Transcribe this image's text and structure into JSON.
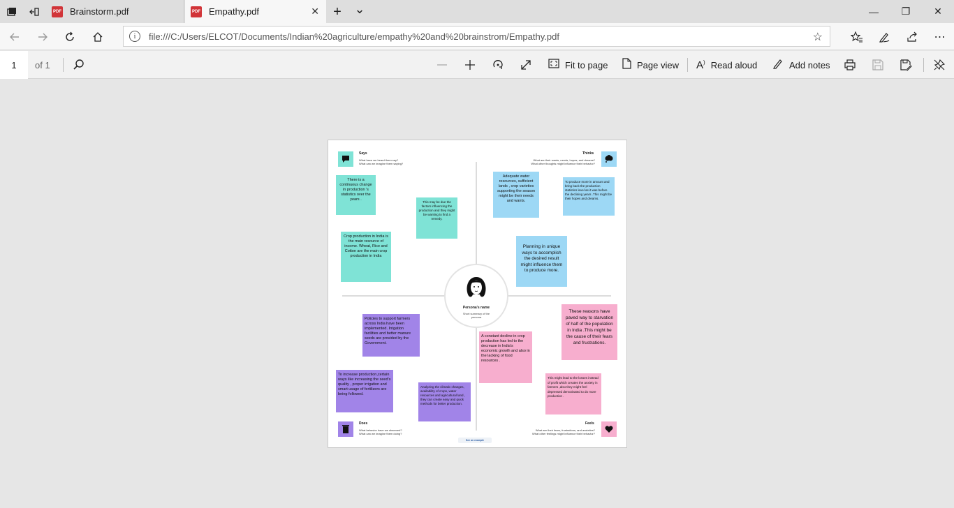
{
  "tabs": [
    {
      "label": "Brainstorm.pdf",
      "active": false
    },
    {
      "label": "Empathy.pdf",
      "active": true
    }
  ],
  "icons": {
    "pdf_badge": "PDF",
    "tab_close": "✕",
    "new_tab": "+",
    "tab_list": "⌄",
    "minimize": "—",
    "maximize": "❐",
    "window_close": "✕"
  },
  "address_bar": {
    "url": "file:///C:/Users/ELCOT/Documents/Indian%20agriculture/empathy%20and%20brainstrom/Empathy.pdf"
  },
  "pdf_toolbar": {
    "page_number": "1",
    "page_of": "of 1",
    "fit_to_page": "Fit to page",
    "page_view": "Page view",
    "read_aloud": "Read aloud",
    "add_notes": "Add notes"
  },
  "document": {
    "persona": {
      "name": "Persona's name",
      "summary": "Short summary of the persona"
    },
    "quadrants": {
      "says": {
        "title": "Says",
        "desc1": "What have we heard them say?",
        "desc2": "What can we imagine them saying?"
      },
      "thinks": {
        "title": "Thinks",
        "desc1": "What are their wants, needs, hopes, and dreams?",
        "desc2": "What other thoughts might influence their behavior?"
      },
      "does": {
        "title": "Does",
        "desc1": "What behavior have we observed?",
        "desc2": "What can we imagine them doing?"
      },
      "feels": {
        "title": "Feels",
        "desc1": "What are their fears, frustrations, and anxieties?",
        "desc2": "What other feelings might influence their behavior?"
      }
    },
    "notes": {
      "says_1": "There is a continuous change in production 's statistics over the years .",
      "says_2": "This may be due the factors influencing the production and they might be wanting to find a remedy.",
      "says_3": "Crop production in India is the main resource of income. Wheat, Rice and Cotton are the main crop production in India",
      "thinks_1": "Adequate water resources, sufficient lands , crop varieties supporting the season might be their needs and wants.",
      "thinks_2": "To produce more in amount and bring back the production statistics level as it was before the declining years .This might be their hopes and dreams.",
      "thinks_3": "Planning in unique ways to accomplish the desired result might influence them to produce more.",
      "does_1": "Policies to support farmers across India have been implemented. Irrigation facilities and better manure seeds are provided by the Government.",
      "does_2": "To increase production,certain ways like increasing the seed's quality , proper irrigation and smart usage of fertilizers are being followed.",
      "does_3": "Analyzing the climatic changes, availability of crops, water resources and agricultural land , they can create easy and quick methods for better production.",
      "feels_1": "These reasons have paved way to starvation of half of the population in India .This might be the cause of their fears and frustrations.",
      "feels_2": "A constant decline in crop production has led to the decrease in India's economic growth and also in the lacking of food resources .",
      "feels_3": "This might lead to the losses instead of profit which creates the anxiety in farmers ,also they might feel depressed demotivated to do more production ."
    },
    "see_example": "See an example"
  },
  "colors": {
    "teal": "#7fe3d6",
    "blue": "#9dd8f5",
    "pink": "#f7aece",
    "purple": "#a184e8"
  }
}
